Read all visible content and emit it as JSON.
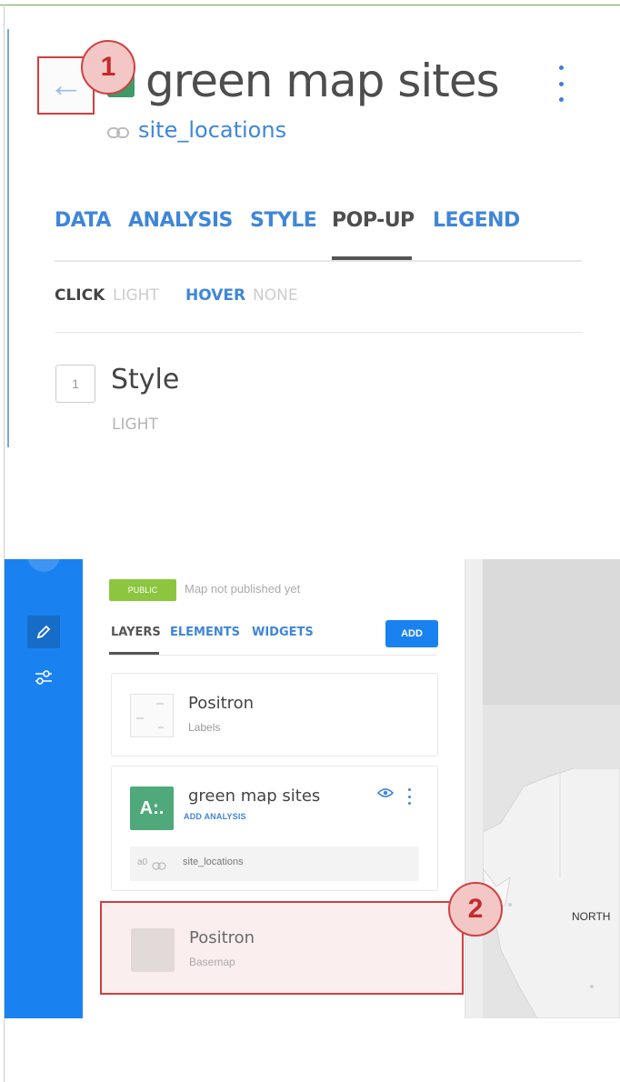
{
  "panel1": {
    "title": "green map sites",
    "source": "site_locations",
    "back_icon": "←",
    "tabs": [
      "DATA",
      "ANALYSIS",
      "STYLE",
      "POP-UP",
      "LEGEND"
    ],
    "active_tab": "POP-UP",
    "click_label": "CLICK",
    "click_value": "LIGHT",
    "hover_label": "HOVER",
    "hover_value": "NONE",
    "step_number": "1",
    "style_label": "Style",
    "style_value": "LIGHT"
  },
  "panel2": {
    "public_badge": "PUBLIC",
    "publish_status": "Map not published yet",
    "tabs": [
      "LAYERS",
      "ELEMENTS",
      "WIDGETS"
    ],
    "active_tab": "LAYERS",
    "add_button": "ADD",
    "layers": [
      {
        "name": "Positron",
        "subtitle": "Labels"
      },
      {
        "name": "green map sites",
        "letter": "A:.",
        "action": "ADD ANALYSIS",
        "source_id": "a0",
        "source": "site_locations"
      }
    ],
    "basemap": {
      "name": "Positron",
      "subtitle": "Basemap"
    },
    "map_label": "NORTH"
  },
  "callouts": [
    "1",
    "2"
  ],
  "colors": {
    "accent_blue": "#3f86d9",
    "callout_red": "#d23f3f",
    "sidebar_blue": "#1a82f0",
    "layer_green": "#4fa97a",
    "public_green": "#8cc63f"
  },
  "icons": {
    "back": "arrow-left-icon",
    "link": "link-icon",
    "edit": "pencil-icon",
    "settings": "sliders-icon",
    "visibility": "eye-icon",
    "options": "kebab-icon"
  }
}
